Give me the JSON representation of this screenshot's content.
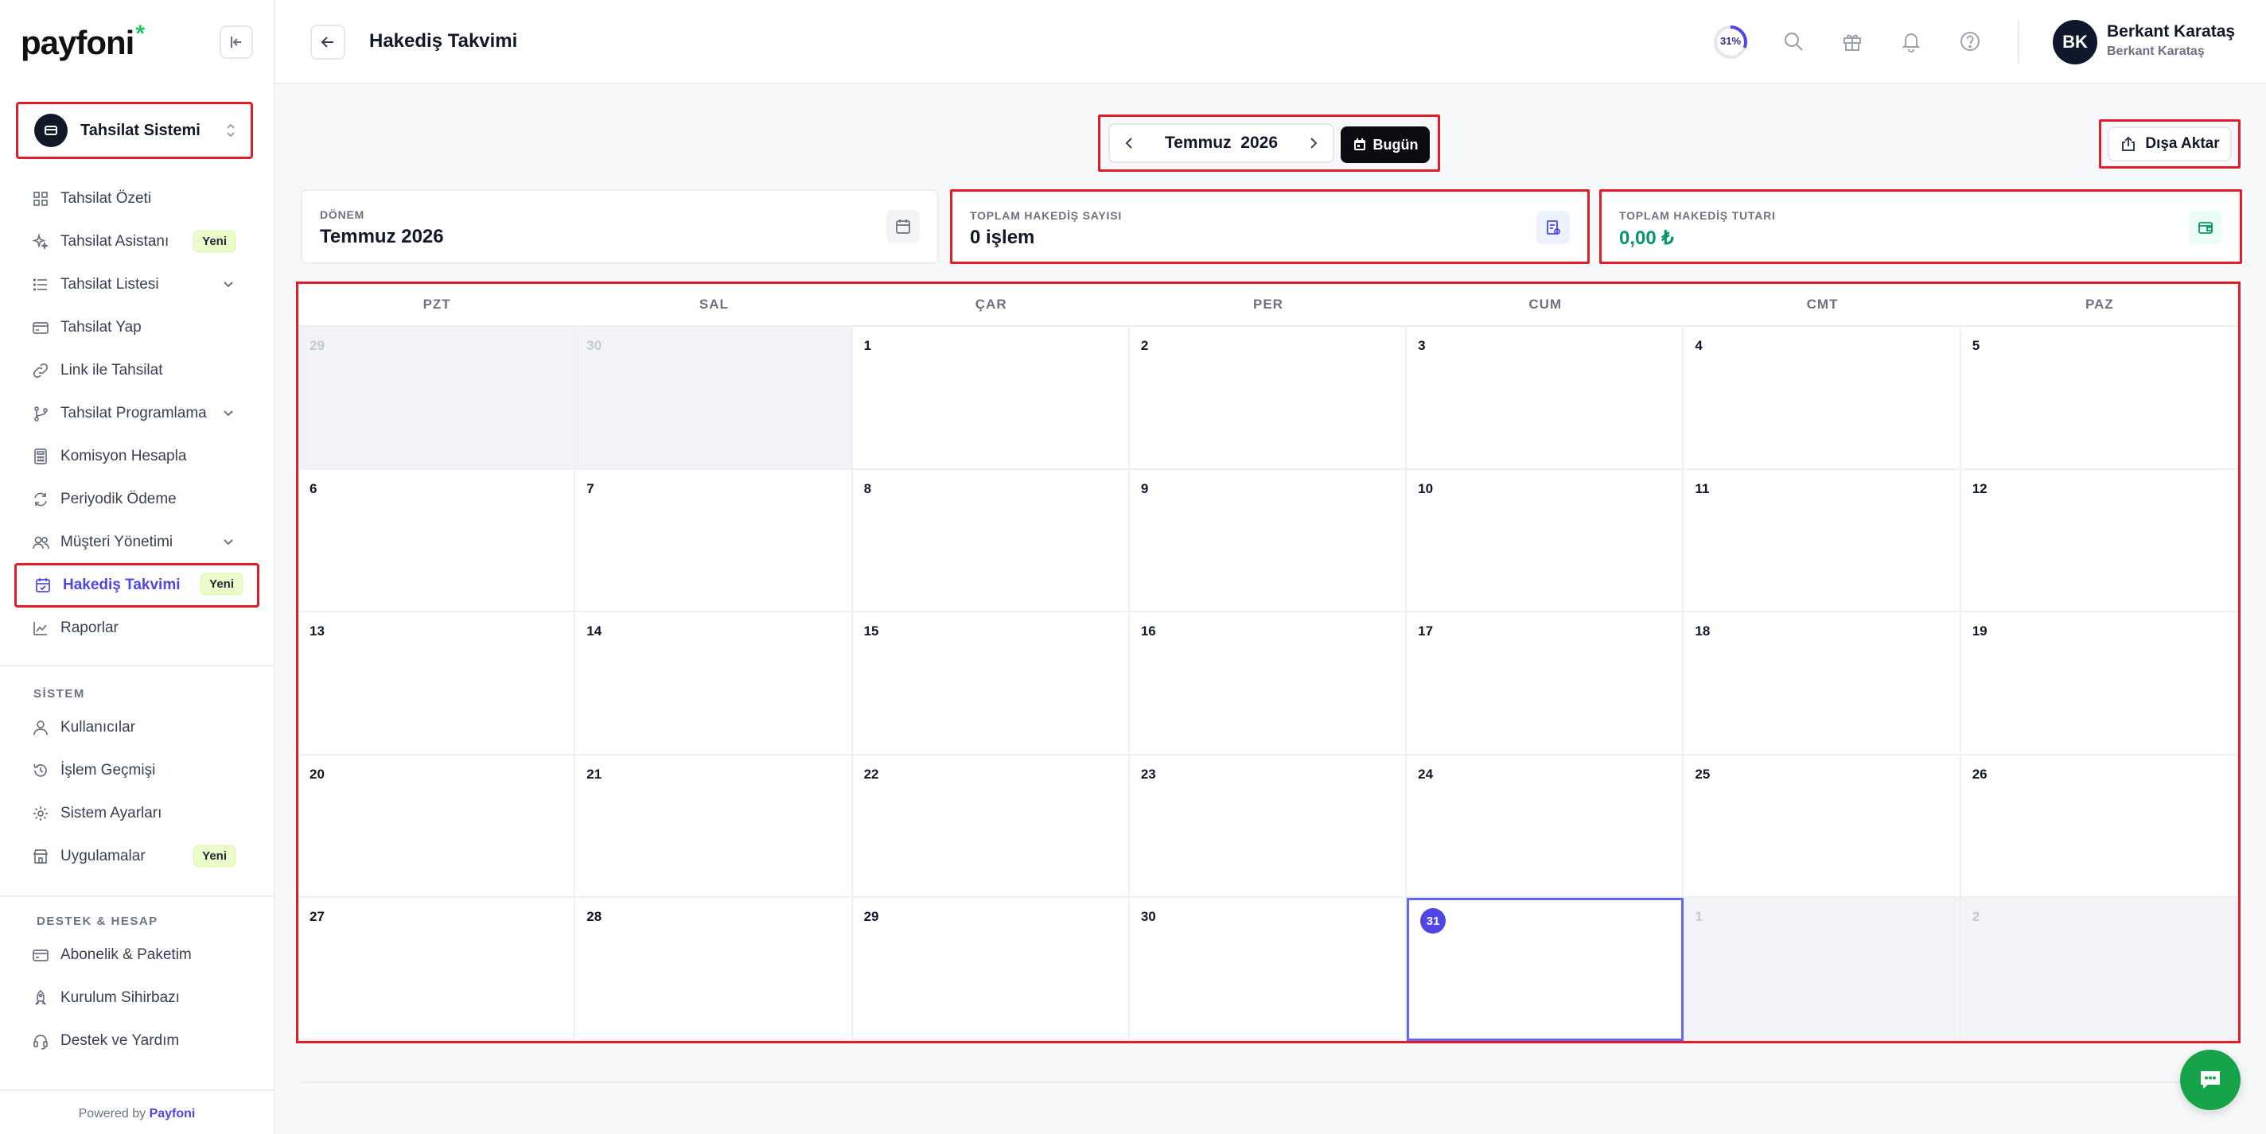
{
  "brand": {
    "logo_text": "payfoni",
    "logo_star": "*",
    "accent": "#4f46e5",
    "green": "#22c55e"
  },
  "sidebar": {
    "org_name": "Tahsilat Sistemi",
    "items": [
      {
        "label": "Tahsilat Özeti",
        "icon": "grid-icon"
      },
      {
        "label": "Tahsilat Asistanı",
        "icon": "sparkle-icon",
        "badge": "Yeni"
      },
      {
        "label": "Tahsilat Listesi",
        "icon": "list-icon",
        "expandable": true
      },
      {
        "label": "Tahsilat Yap",
        "icon": "card-icon"
      },
      {
        "label": "Link ile Tahsilat",
        "icon": "link-icon"
      },
      {
        "label": "Tahsilat Programlama",
        "icon": "branch-icon",
        "expandable": true
      },
      {
        "label": "Komisyon Hesapla",
        "icon": "calculator-icon"
      },
      {
        "label": "Periyodik Ödeme",
        "icon": "refresh-icon"
      },
      {
        "label": "Müşteri Yönetimi",
        "icon": "users-icon",
        "expandable": true
      },
      {
        "label": "Hakediş Takvimi",
        "icon": "calendar-check-icon",
        "badge": "Yeni",
        "active": true
      },
      {
        "label": "Raporlar",
        "icon": "chart-icon"
      }
    ],
    "system_label": "SİSTEM",
    "system_items": [
      {
        "label": "Kullanıcılar",
        "icon": "user-icon"
      },
      {
        "label": "İşlem Geçmişi",
        "icon": "history-icon"
      },
      {
        "label": "Sistem Ayarları",
        "icon": "gear-icon"
      },
      {
        "label": "Uygulamalar",
        "icon": "store-icon",
        "badge": "Yeni"
      }
    ],
    "support_label": "DESTEK & HESAP",
    "support_items": [
      {
        "label": "Abonelik & Paketim",
        "icon": "card-icon"
      },
      {
        "label": "Kurulum Sihirbazı",
        "icon": "rocket-icon"
      },
      {
        "label": "Destek ve Yardım",
        "icon": "headset-icon"
      }
    ],
    "powered_prefix": "Powered by",
    "powered_brand": "Payfoni"
  },
  "header": {
    "title": "Hakediş Takvimi",
    "progress": "31%",
    "progress_value": 0.31,
    "user_initials": "BK",
    "user_name": "Berkant Karataş",
    "user_sub": "Berkant Karataş"
  },
  "toolbar": {
    "month": "Temmuz",
    "year": "2026",
    "today_label": "Bugün",
    "export_label": "Dışa Aktar"
  },
  "stats": {
    "period_label": "DÖNEM",
    "period_value": "Temmuz 2026",
    "count_label": "TOPLAM HAKEDİŞ SAYISI",
    "count_value": "0 işlem",
    "total_label": "TOPLAM HAKEDİŞ TUTARI",
    "total_value": "0,00 ₺"
  },
  "calendar": {
    "weekdays": [
      "PZT",
      "SAL",
      "ÇAR",
      "PER",
      "CUM",
      "CMT",
      "PAZ"
    ],
    "days": [
      {
        "d": "29",
        "out": true
      },
      {
        "d": "30",
        "out": true
      },
      {
        "d": "1"
      },
      {
        "d": "2"
      },
      {
        "d": "3"
      },
      {
        "d": "4"
      },
      {
        "d": "5"
      },
      {
        "d": "6"
      },
      {
        "d": "7"
      },
      {
        "d": "8"
      },
      {
        "d": "9"
      },
      {
        "d": "10"
      },
      {
        "d": "11"
      },
      {
        "d": "12"
      },
      {
        "d": "13"
      },
      {
        "d": "14"
      },
      {
        "d": "15"
      },
      {
        "d": "16"
      },
      {
        "d": "17"
      },
      {
        "d": "18"
      },
      {
        "d": "19"
      },
      {
        "d": "20"
      },
      {
        "d": "21"
      },
      {
        "d": "22"
      },
      {
        "d": "23"
      },
      {
        "d": "24"
      },
      {
        "d": "25"
      },
      {
        "d": "26"
      },
      {
        "d": "27"
      },
      {
        "d": "28"
      },
      {
        "d": "29"
      },
      {
        "d": "30"
      },
      {
        "d": "31",
        "today": true
      },
      {
        "d": "1",
        "out": true
      },
      {
        "d": "2",
        "out": true
      }
    ]
  }
}
